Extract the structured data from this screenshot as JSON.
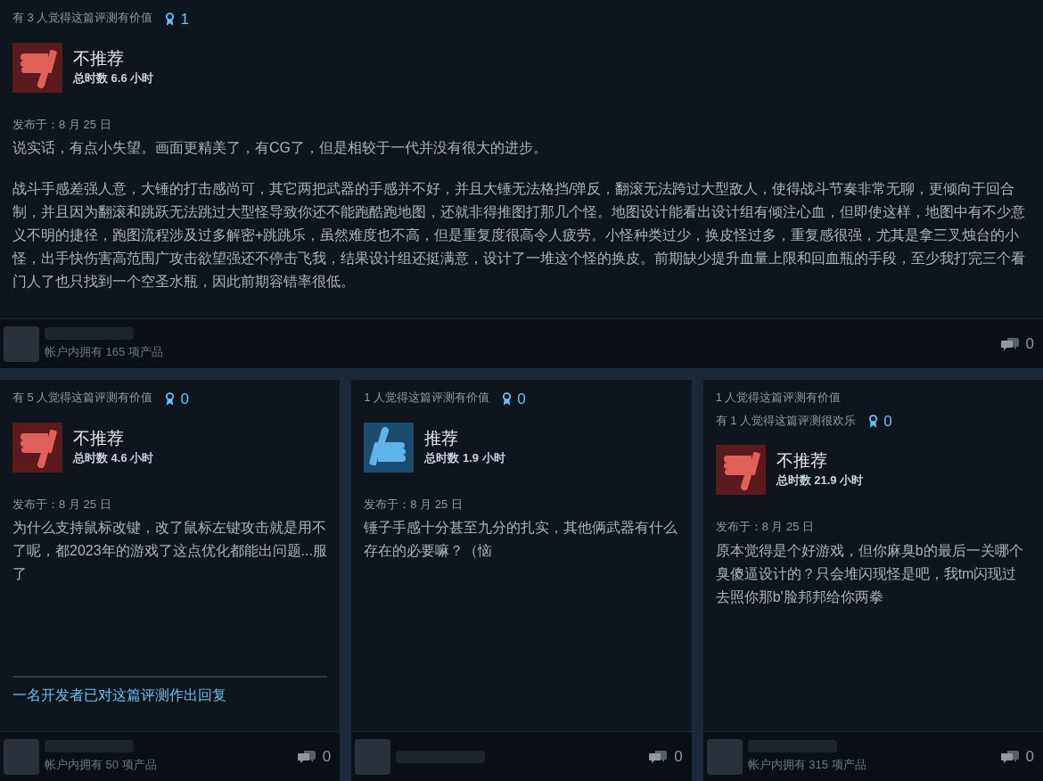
{
  "reviews": [
    {
      "helpful": [
        "有 3 人觉得这篇评测有价值"
      ],
      "awards": "1",
      "recommended": false,
      "verdict": "不推荐",
      "hours": "总时数 6.6 小时",
      "date": "发布于：8 月 25 日",
      "paragraphs": [
        "说实话，有点小失望。画面更精美了，有CG了，但是相较于一代并没有很大的进步。",
        "战斗手感差强人意，大锤的打击感尚可，其它两把武器的手感并不好，并且大锤无法格挡/弹反，翻滚无法跨过大型敌人，使得战斗节奏非常无聊，更倾向于回合制，并且因为翻滚和跳跃无法跳过大型怪导致你还不能跑酷跑地图，还就非得推图打那几个怪。地图设计能看出设计组有倾注心血，但即使这样，地图中有不少意义不明的捷径，跑图流程涉及过多解密+跳跳乐，虽然难度也不高，但是重复度很高令人疲劳。小怪种类过少，换皮怪过多，重复感很强，尤其是拿三叉烛台的小怪，出手快伤害高范围广攻击欲望强还不停击飞我，结果设计组还挺满意，设计了一堆这个怪的换皮。前期缺少提升血量上限和回血瓶的手段，至少我打完三个看门人了也只找到一个空圣水瓶，因此前期容错率很低。"
      ],
      "products": "帐户内拥有 165 项产品",
      "comments": "0"
    },
    {
      "helpful": [
        "有 5 人觉得这篇评测有价值"
      ],
      "awards": "0",
      "recommended": false,
      "verdict": "不推荐",
      "hours": "总时数 4.6 小时",
      "date": "发布于：8 月 25 日",
      "paragraphs": [
        "为什么支持鼠标改键，改了鼠标左键攻击就是用不了呢，都2023年的游戏了这点优化都能出问题...服了"
      ],
      "developer_reply": "一名开发者已对这篇评测作出回复",
      "products": "帐户内拥有 50 项产品",
      "comments": "0"
    },
    {
      "helpful": [
        "1 人觉得这篇评测有价值"
      ],
      "awards": "0",
      "recommended": true,
      "verdict": "推荐",
      "hours": "总时数 1.9 小时",
      "date": "发布于：8 月 25 日",
      "paragraphs": [
        "锤子手感十分甚至九分的扎实，其他俩武器有什么存在的必要嘛？（恼"
      ],
      "comments": "0"
    },
    {
      "helpful": [
        "1 人觉得这篇评测有价值",
        "有 1 人觉得这篇评测很欢乐"
      ],
      "awards": "0",
      "recommended": false,
      "verdict": "不推荐",
      "hours": "总时数 21.9 小时",
      "date": "发布于：8 月 25 日",
      "paragraphs": [
        "原本觉得是个好游戏，但你麻臭b的最后一关哪个臭傻逼设计的？只会堆闪现怪是吧，我tm闪现过去照你那b'脸邦邦给你两拳"
      ],
      "products": "帐户内拥有 315 项产品",
      "comments": "0"
    }
  ]
}
